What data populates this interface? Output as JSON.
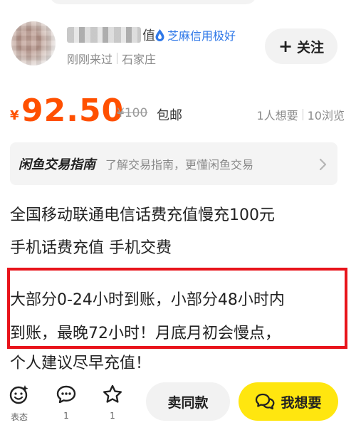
{
  "seller": {
    "name_suffix": "值",
    "credit_label": "芝麻信用极好",
    "last_seen": "刚刚来过",
    "location": "石家庄",
    "follow_label": "关注"
  },
  "price": {
    "currency": "¥",
    "amount": "92.50",
    "original": "¥100",
    "shipping": "包邮"
  },
  "stats": {
    "wants": "1人想要",
    "views": "10浏览"
  },
  "guide": {
    "title": "闲鱼交易指南",
    "desc": "了解交易指南，更懂闲鱼交易"
  },
  "listing": {
    "title_line1": "全国移动联通电信话费充值慢充100元",
    "title_line2": "手机话费充值 手机交费",
    "desc_line1": "大部分0-24小时到账，小部分48小时内",
    "desc_line2": "到账，最晚72小时！月底月初会慢点，",
    "desc_line3": "个人建议尽早充值！"
  },
  "bottom_bar": {
    "emoji_label": "表态",
    "comment_count": "1",
    "favorite_count": "1",
    "sell_same_label": "卖同款",
    "want_label": "我想要"
  },
  "colors": {
    "price": "#ff5000",
    "credit": "#2f78e8",
    "highlight_border": "#e8141b",
    "want_button": "#ffe60f"
  },
  "icons": {
    "credit": "drop-icon",
    "guide": "chevron-right-icon",
    "emoji": "emoji-icon",
    "comment": "comment-icon",
    "favorite": "star-icon",
    "want": "chat-bubbles-icon"
  }
}
